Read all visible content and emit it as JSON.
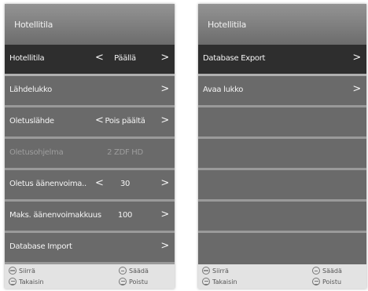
{
  "left_panel": {
    "title": "Hotellitila",
    "rows": [
      {
        "label": "Hotellitila",
        "value": "Päällä",
        "lt": "<",
        "gt": ">"
      },
      {
        "label": "Lähdelukko",
        "gt": ">"
      },
      {
        "label": "Oletuslähde",
        "value": "Pois päältä",
        "lt": "<",
        "gt": ">"
      },
      {
        "label": "Oletusohjelma",
        "value": "2 ZDF HD"
      },
      {
        "label": "Oletus äänenvoima..",
        "value": "30",
        "lt": "<",
        "gt": ">"
      },
      {
        "label": "Maks. äänenvoimakkuus",
        "value": "100",
        "gt": ">"
      },
      {
        "label": "Database Import",
        "gt": ">"
      }
    ],
    "footer": {
      "move": "Siirrä",
      "adjust": "Säädä",
      "back": "Takaisin",
      "exit": "Poistu"
    }
  },
  "right_panel": {
    "title": "Hotellitila",
    "rows": [
      {
        "label": "Database Export",
        "gt": ">"
      },
      {
        "label": "Avaa lukko",
        "gt": ">"
      }
    ],
    "footer": {
      "move": "Siirrä",
      "adjust": "Säädä",
      "back": "Takaisin",
      "exit": "Poistu"
    }
  }
}
